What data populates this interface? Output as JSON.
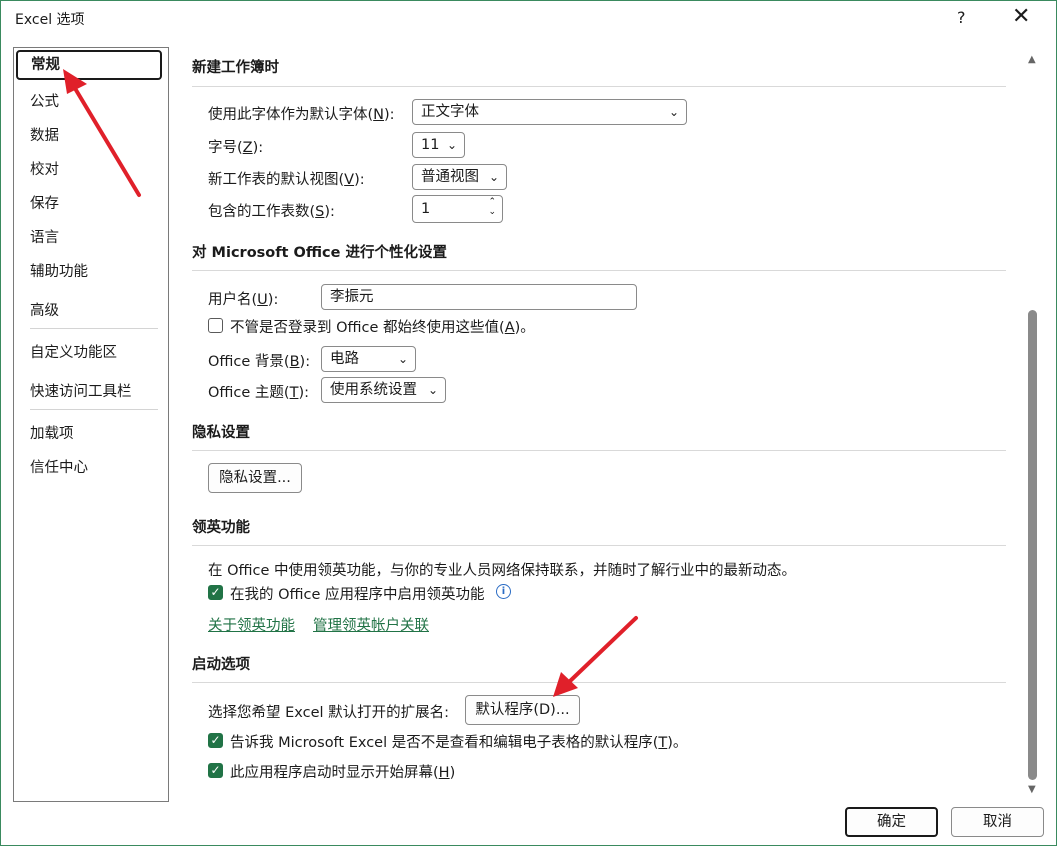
{
  "window": {
    "title": "Excel 选项",
    "help": "?",
    "close": "✕"
  },
  "nav": {
    "items": [
      "常规",
      "公式",
      "数据",
      "校对",
      "保存",
      "语言",
      "辅助功能",
      "高级",
      "自定义功能区",
      "快速访问工具栏",
      "加载项",
      "信任中心"
    ],
    "selected": "常规"
  },
  "sections": {
    "new_workbook": {
      "title": "新建工作簿时",
      "font_label": "使用此字体作为默认字体(",
      "font_key": "N",
      "font_label_end": "):",
      "font_value": "正文字体",
      "size_label": "字号(",
      "size_key": "Z",
      "size_label_end": "):",
      "size_value": "11",
      "view_label": "新工作表的默认视图(",
      "view_key": "V",
      "view_label_end": "):",
      "view_value": "普通视图",
      "sheets_label": "包含的工作表数(",
      "sheets_key": "S",
      "sheets_label_end": "):",
      "sheets_value": "1"
    },
    "personalize": {
      "title": "对 Microsoft Office 进行个性化设置",
      "username_label": "用户名(",
      "username_key": "U",
      "username_label_end": "):",
      "username_value": "李振元",
      "always_label": "不管是否登录到 Office 都始终使用这些值(",
      "always_key": "A",
      "always_label_end": ")。",
      "bg_label": "Office 背景(",
      "bg_key": "B",
      "bg_label_end": "):",
      "bg_value": "电路",
      "theme_label": "Office 主题(",
      "theme_key": "T",
      "theme_label_end": "):",
      "theme_value": "使用系统设置"
    },
    "privacy": {
      "title": "隐私设置",
      "button": "隐私设置..."
    },
    "linkedin": {
      "title": "领英功能",
      "description": "在 Office 中使用领英功能，与你的专业人员网络保持联系，并随时了解行业中的最新动态。",
      "enable_label": "在我的 Office 应用程序中启用领英功能",
      "link_about": "关于领英功能",
      "link_manage": "管理领英帐户关联"
    },
    "startup": {
      "title": "启动选项",
      "ext_label": "选择您希望 Excel 默认打开的扩展名:",
      "default_button": "默认程序(D)...",
      "tell_me_label": "告诉我 Microsoft Excel 是否不是查看和编辑电子表格的默认程序(",
      "tell_me_key": "T",
      "tell_me_end": ")。",
      "splash_label": "此应用程序启动时显示开始屏幕(",
      "splash_key": "H",
      "splash_end": ")"
    }
  },
  "footer": {
    "ok": "确定",
    "cancel": "取消"
  },
  "icons": {
    "chevron": "⌄",
    "check": "✓",
    "info": "i",
    "scroll_up": "▲",
    "scroll_down": "▼",
    "spin_up": "⌃",
    "spin_down": "⌄"
  },
  "colors": {
    "accent": "#217346",
    "arrow": "#e0202a",
    "frame": "#3a8a5e"
  }
}
